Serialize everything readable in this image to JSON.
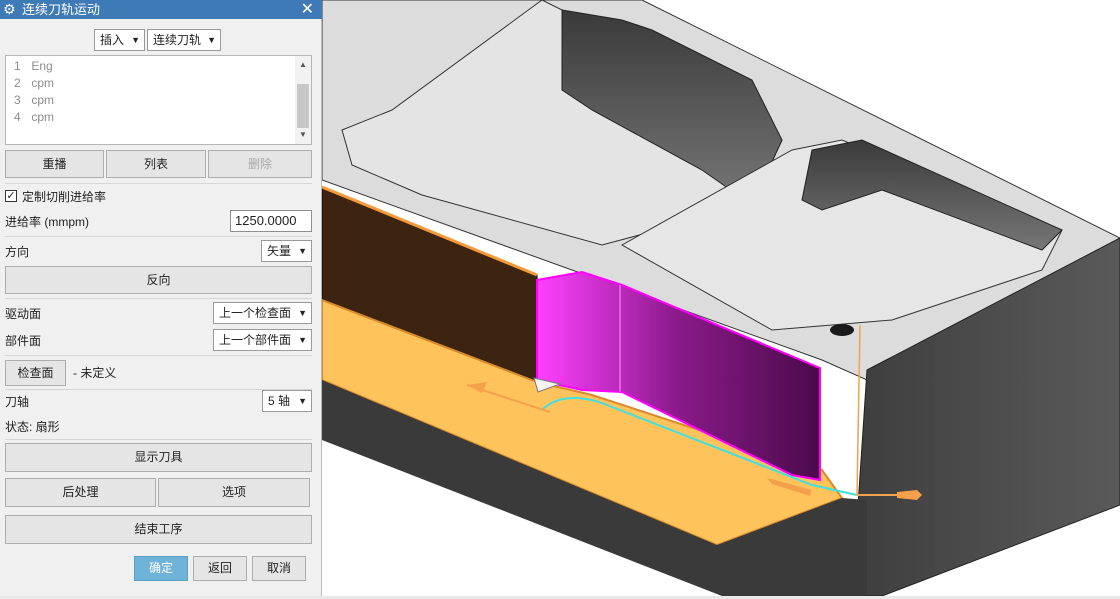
{
  "dialog": {
    "title": "连续刀轨运动",
    "insert_dropdown": "插入",
    "motion_dropdown": "连续刀轨",
    "list_items": [
      {
        "num": "1",
        "text": "Eng"
      },
      {
        "num": "2",
        "text": "cpm"
      },
      {
        "num": "3",
        "text": "cpm"
      },
      {
        "num": "4",
        "text": "cpm"
      }
    ],
    "buttons": {
      "replay": "重播",
      "list": "列表",
      "delete": "删除",
      "reverse": "反向",
      "check_surface": "检查面",
      "show_tool": "显示刀具",
      "post_process": "后处理",
      "options": "选项",
      "end_operation": "结束工序",
      "ok": "确定",
      "back": "返回",
      "cancel": "取消"
    },
    "custom_feed": {
      "checked": true,
      "label": "定制切削进给率"
    },
    "feed_rate": {
      "label": "进给率 (mmpm)",
      "value": "1250.0000"
    },
    "direction": {
      "label": "方向",
      "value": "矢量"
    },
    "drive_surface": {
      "label": "驱动面",
      "value": "上一个检查面"
    },
    "part_surface": {
      "label": "部件面",
      "value": "上一个部件面"
    },
    "check_surface_status": "- 未定义",
    "tool_axis": {
      "label": "刀轴",
      "value": "5 轴"
    },
    "status": "状态: 扇形"
  },
  "viewport": {
    "colors": {
      "gray_wall": "#4a4a4a",
      "top_face": "#dcdcdc",
      "floor_orange": "#ffc35c",
      "wall_magenta": "#4b0a4b",
      "edge_magenta": "#ff00ff",
      "path_cyan": "#40e0e0",
      "vector_orange": "#f5a04a"
    }
  }
}
